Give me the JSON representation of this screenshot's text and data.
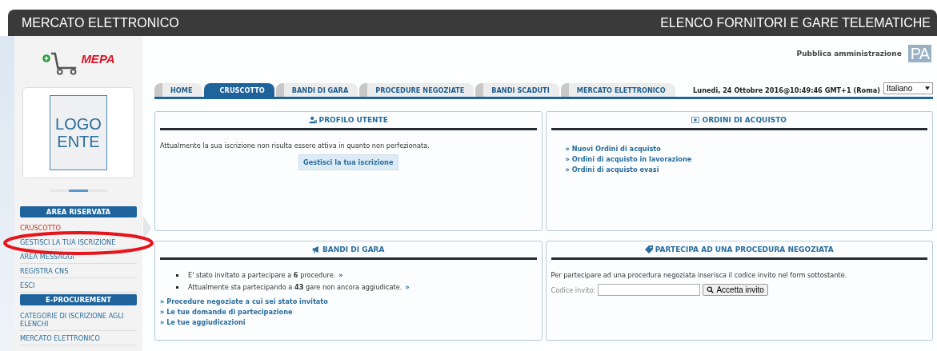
{
  "header": {
    "left": "MERCATO ELETTRONICO",
    "right": "ELENCO FORNITORI E GARE TELEMATICHE"
  },
  "logo": {
    "text": "MEPA"
  },
  "entity_logo": {
    "lines": [
      "LOGO",
      "ENTE"
    ]
  },
  "sidebar": {
    "sections": [
      {
        "title": "AREA RISERVATA",
        "items": [
          {
            "label": "CRUSCOTTO",
            "selected": true,
            "circled": false
          },
          {
            "label": "GESTISCI LA TUA ISCRIZIONE",
            "selected": false,
            "circled": true
          },
          {
            "label": "AREA MESSAGGI",
            "selected": false,
            "circled": false
          },
          {
            "label": "REGISTRA CNS",
            "selected": false,
            "circled": false
          },
          {
            "label": "ESCI",
            "selected": false,
            "circled": false
          }
        ]
      },
      {
        "title": "E-PROCUREMENT",
        "items": [
          {
            "label": "CATEGORIE DI ISCRIZIONE AGLI ELENCHI",
            "selected": false,
            "circled": false
          },
          {
            "label": "MERCATO ELETTRONICO",
            "selected": false,
            "circled": false
          }
        ]
      }
    ]
  },
  "top_right": {
    "label": "Pubblica amministrazione",
    "mark": "PA"
  },
  "tabs": [
    {
      "label": "HOME",
      "selected": false
    },
    {
      "label": "CRUSCOTTO",
      "selected": true
    },
    {
      "label": "BANDI DI GARA",
      "selected": false
    },
    {
      "label": "PROCEDURE NEGOZIATE",
      "selected": false
    },
    {
      "label": "BANDI SCADUTI",
      "selected": false
    },
    {
      "label": "MERCATO ELETTRONICO",
      "selected": false
    }
  ],
  "datetime": "Lunedi, 24 Ottobre 2016@10:49:46 GMT+1 (Roma)",
  "language_select": {
    "value": "Italiano"
  },
  "panels": [
    {
      "kind": "profile",
      "title": "PROFILO UTENTE",
      "text": "Attualmente la sua iscrizione non risulta essere attiva in quanto non perfezionata.",
      "button": "Gestisci la tua iscrizione"
    },
    {
      "kind": "orders",
      "title": "ORDINI DI ACQUISTO",
      "links": [
        "» Nuovi Ordini di acquisto",
        "» Ordini di acquisto in lavorazione",
        "» Ordini di acquisto evasi"
      ]
    },
    {
      "kind": "tenders",
      "title": "BANDI DI GARA",
      "bullets": [
        {
          "text": "E' stato invitato a partecipare a **6** procedure.",
          "link": "»"
        },
        {
          "text": "Attualmente sta partecipando a **43** gare non ancora aggiudicate.",
          "link": "»"
        }
      ],
      "links": [
        "» Procedure negoziate a cui sei stato invitato",
        "» Le tue domande di partecipazione",
        "» Le tue aggiudicazioni"
      ]
    },
    {
      "kind": "invite",
      "title": "PARTECIPA AD UNA PROCEDURA NEGOZIATA",
      "text": "Per partecipare ad una procedura negoziata inserisca il codice invito nel form sottostante.",
      "field_label": "Codice invito:",
      "button": "Accetta invito"
    }
  ]
}
